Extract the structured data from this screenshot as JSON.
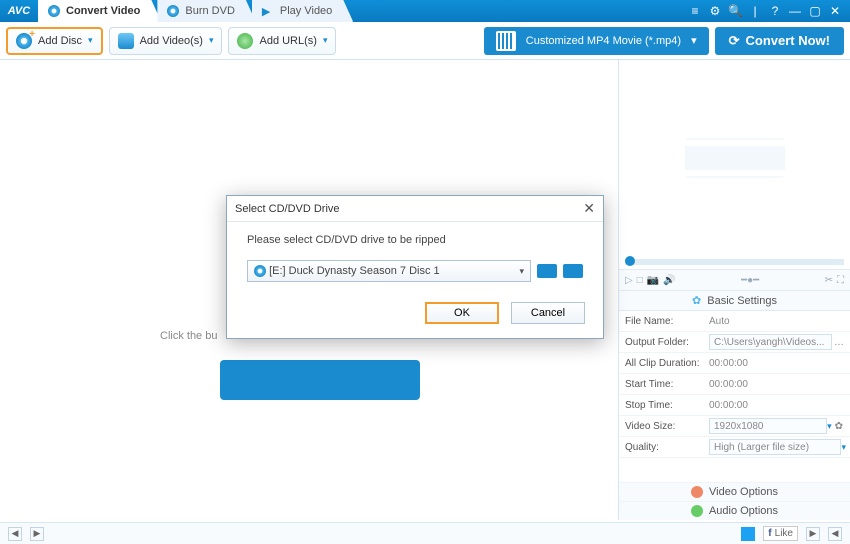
{
  "app": {
    "logo": "AVC"
  },
  "tabs": [
    {
      "label": "Convert Video",
      "active": true
    },
    {
      "label": "Burn DVD",
      "active": false
    },
    {
      "label": "Play Video",
      "active": false
    }
  ],
  "toolbar": {
    "add_disc": "Add Disc",
    "add_videos": "Add Video(s)",
    "add_urls": "Add URL(s)",
    "format": "Customized MP4 Movie (*.mp4)",
    "convert": "Convert Now!"
  },
  "main": {
    "hint": "Click the bu"
  },
  "dialog": {
    "title": "Select CD/DVD Drive",
    "prompt": "Please select CD/DVD drive to be ripped",
    "drive": "[E:] Duck Dynasty Season 7 Disc 1",
    "ok": "OK",
    "cancel": "Cancel"
  },
  "settings": {
    "header": "Basic Settings",
    "file_name_k": "File Name:",
    "file_name_v": "Auto",
    "out_folder_k": "Output Folder:",
    "out_folder_v": "C:\\Users\\yangh\\Videos...",
    "clip_dur_k": "All Clip Duration:",
    "clip_dur_v": "00:00:00",
    "start_k": "Start Time:",
    "start_v": "00:00:00",
    "stop_k": "Stop Time:",
    "stop_v": "00:00:00",
    "vsize_k": "Video Size:",
    "vsize_v": "1920x1080",
    "quality_k": "Quality:",
    "quality_v": "High (Larger file size)"
  },
  "options": {
    "video": "Video Options",
    "audio": "Audio Options"
  },
  "statusbar": {
    "like": "Like"
  }
}
